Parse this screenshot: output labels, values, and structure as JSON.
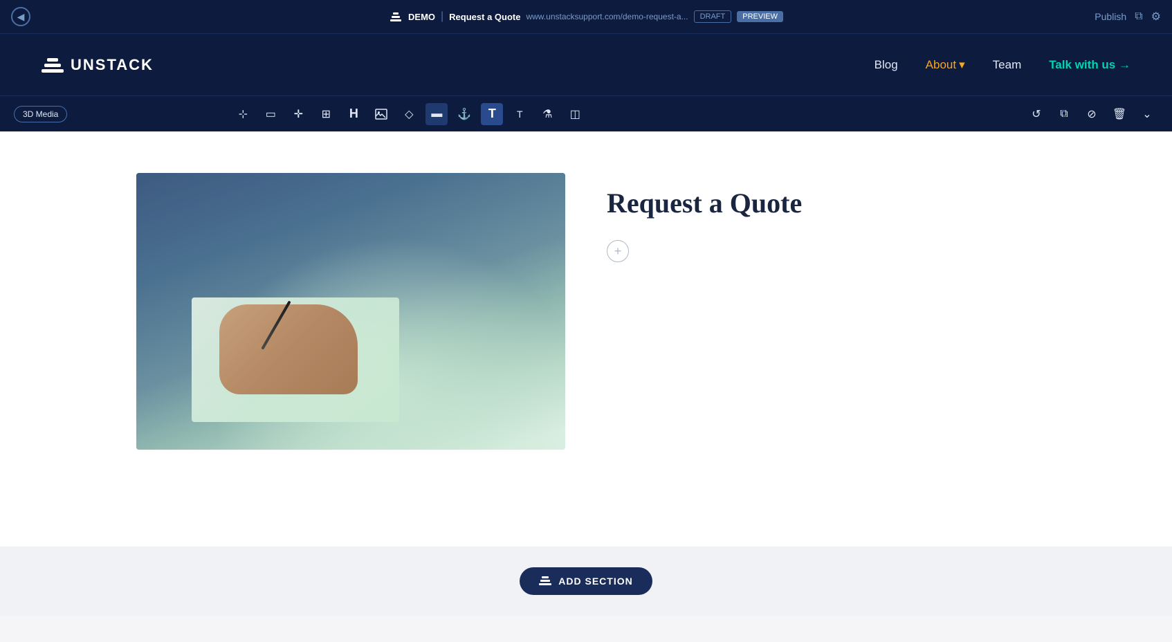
{
  "editor_bar": {
    "back_label": "←",
    "demo_label": "DEMO",
    "separator": "|",
    "page_name": "Request a Quote",
    "url": "www.unstacksupport.com/demo-request-a...",
    "draft_label": "DRAFT",
    "preview_label": "PREVIEW",
    "publish_label": "Publish"
  },
  "nav": {
    "logo_text": "UNSTACK",
    "links": [
      {
        "label": "Blog",
        "type": "normal"
      },
      {
        "label": "About",
        "type": "about"
      },
      {
        "label": "Team",
        "type": "normal"
      },
      {
        "label": "Talk with us →",
        "type": "cta"
      }
    ]
  },
  "toolbar": {
    "label_3d": "3D Media",
    "icons": [
      {
        "name": "select-icon",
        "symbol": "⊹"
      },
      {
        "name": "frame-icon",
        "symbol": "▭"
      },
      {
        "name": "move-icon",
        "symbol": "✛"
      },
      {
        "name": "grid-icon",
        "symbol": "⊞"
      },
      {
        "name": "heading-icon",
        "symbol": "H"
      },
      {
        "name": "image-icon",
        "symbol": "🖼"
      },
      {
        "name": "shape-icon",
        "symbol": "◇"
      },
      {
        "name": "section-icon",
        "symbol": "▬"
      },
      {
        "name": "anchor-icon",
        "symbol": "⚓"
      },
      {
        "name": "text-bold-icon",
        "symbol": "T"
      },
      {
        "name": "text-icon",
        "symbol": "T"
      },
      {
        "name": "lab-icon",
        "symbol": "⚗"
      },
      {
        "name": "panel-icon",
        "symbol": "◫"
      }
    ],
    "right_icons": [
      {
        "name": "refresh-icon",
        "symbol": "↺"
      },
      {
        "name": "copy-icon",
        "symbol": "⧉"
      },
      {
        "name": "hide-icon",
        "symbol": "⊘"
      },
      {
        "name": "delete-icon",
        "symbol": "🗑"
      },
      {
        "name": "collapse-icon",
        "symbol": "⌄"
      }
    ]
  },
  "content": {
    "heading": "Request a Quote",
    "add_section_label": "ADD SECTION"
  },
  "colors": {
    "dark_navy": "#0d1b3e",
    "about_color": "#f5a623",
    "cta_color": "#00d4b4",
    "heading_color": "#1a2540"
  }
}
